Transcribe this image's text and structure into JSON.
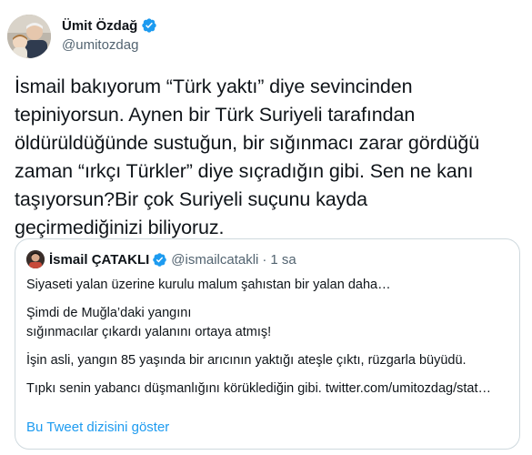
{
  "author": {
    "display_name": "Ümit Özdağ",
    "handle": "@umitozdag",
    "verified_color": "#1d9bf0"
  },
  "tweet": {
    "text": "İsmail bakıyorum “Türk yaktı” diye sevincinden\ntepiniyorsun. Aynen bir Türk Suriyeli tarafından\nöldürüldüğünde sustuğun, bir sığınmacı zarar gördüğü\nzaman “ırkçı Türkler” diye sıçradığın gibi. Sen ne kanı\ntaşıyorsun?Bir çok Suriyeli suçunu kayda\ngeçirmediğinizi biliyoruz."
  },
  "quoted": {
    "display_name": "İsmail ÇATAKLI",
    "handle": "@ismailcatakli",
    "separator": "·",
    "time": "1 sa",
    "lines": [
      "Siyaseti yalan üzerine kurulu malum şahıstan bir yalan daha…",
      "Şimdi de Muğla’daki yangını",
      "sığınmacılar çıkardı yalanını ortaya atmış!",
      "İşin asli, yangın 85 yaşında bir arıcının yaktığı ateşle çıktı, rüzgarla büyüdü.",
      "Tıpkı senin yabancı düşmanlığını körüklediğin gibi. twitter.com/umitozdag/stat…"
    ],
    "show_thread": "Bu Tweet dizisini göster"
  }
}
